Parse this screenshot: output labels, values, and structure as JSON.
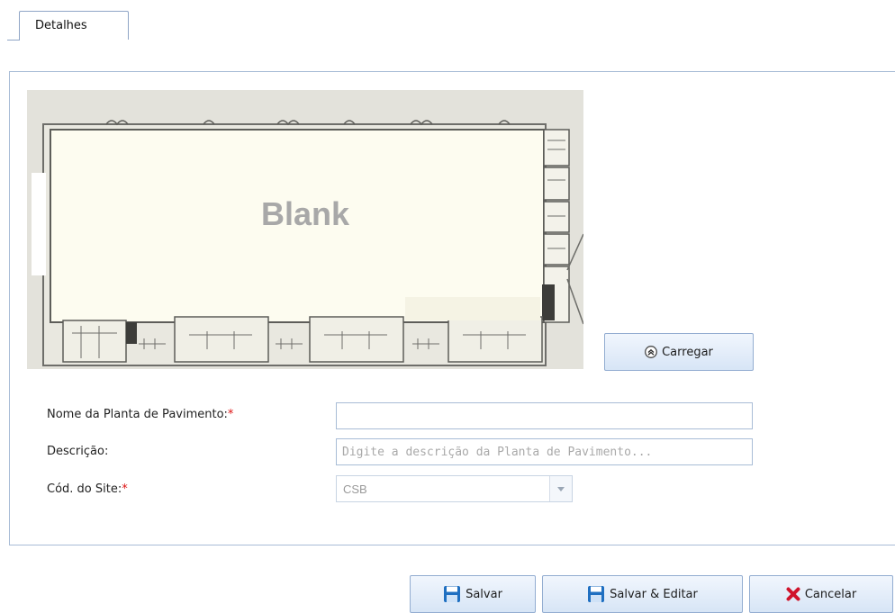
{
  "tabs": [
    {
      "label": "Detalhes",
      "active": true
    }
  ],
  "floorplan": {
    "watermark_text": "Blank"
  },
  "upload_button": {
    "label": "Carregar",
    "icon": "double-chevron-up-icon"
  },
  "form": {
    "name": {
      "label": "Nome da Planta de Pavimento:",
      "required_mark": "*",
      "value": "",
      "placeholder": ""
    },
    "description": {
      "label": "Descrição:",
      "value": "",
      "placeholder": "Digite a descrição da Planta de Pavimento..."
    },
    "site": {
      "label": "Cód. do Site:",
      "required_mark": "*",
      "value": "CSB"
    }
  },
  "actions": {
    "save": {
      "label": "Salvar",
      "icon": "floppy-disk-icon"
    },
    "save_edit": {
      "label": "Salvar & Editar",
      "icon": "floppy-disk-icon"
    },
    "cancel": {
      "label": "Cancelar",
      "icon": "red-x-icon"
    }
  },
  "colors": {
    "accent": "#1f6fc1",
    "border": "#a8bcd6",
    "required": "#dd1111",
    "cancel_icon": "#d0142c"
  }
}
